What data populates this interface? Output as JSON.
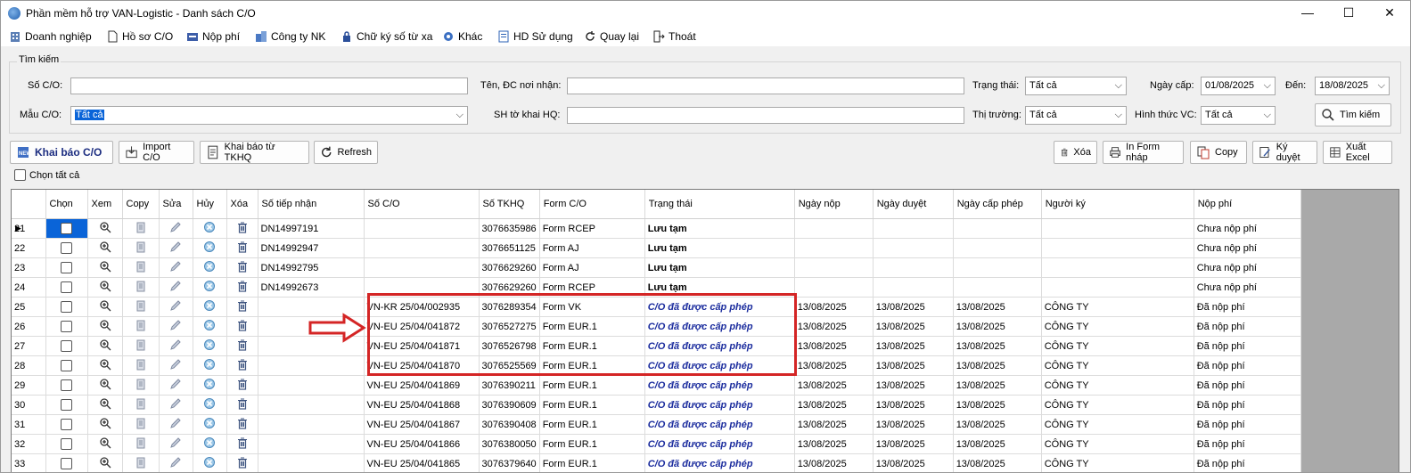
{
  "window": {
    "title": "Phần mềm hỗ trợ VAN-Logistic - Danh sách C/O",
    "minimize": "—",
    "maximize": "☐",
    "close": "✕"
  },
  "menu": [
    {
      "label": "Doanh nghiệp",
      "icon": "building-icon"
    },
    {
      "label": "Hồ sơ C/O",
      "icon": "document-icon"
    },
    {
      "label": "Nộp phí",
      "icon": "payment-icon"
    },
    {
      "label": "Công ty NK",
      "icon": "company-icon"
    },
    {
      "label": "Chữ ký số từ xa",
      "icon": "lock-icon"
    },
    {
      "label": "Khác",
      "icon": "gear-icon"
    },
    {
      "label": "HD Sử dụng",
      "icon": "help-icon"
    },
    {
      "label": "Quay lại",
      "icon": "back-icon"
    },
    {
      "label": "Thoát",
      "icon": "exit-icon"
    }
  ],
  "search": {
    "legend": "Tìm kiếm",
    "so_co_label": "Số C/O:",
    "so_co_value": "",
    "ten_dc_label": "Tên, ĐC nơi nhận:",
    "ten_dc_value": "",
    "trang_thai_label": "Trạng thái:",
    "trang_thai_value": "Tất cả",
    "ngay_cap_label": "Ngày cấp:",
    "ngay_cap_value": "01/08/2025",
    "den_label": "Đến:",
    "den_value": "18/08/2025",
    "mau_co_label": "Mẫu C/O:",
    "mau_co_value": "Tất cả",
    "sh_to_khai_label": "SH tờ khai HQ:",
    "sh_to_khai_value": "",
    "thi_truong_label": "Thị trường:",
    "thi_truong_value": "Tất cả",
    "hinh_thuc_label": "Hình thức VC:",
    "hinh_thuc_value": "Tất cả",
    "search_button": "Tìm kiếm"
  },
  "toolbar": {
    "khai_bao": "Khai báo C/O",
    "import": "Import C/O",
    "khai_bao_tkhq": "Khai báo từ TKHQ",
    "refresh": "Refresh",
    "xoa": "Xóa",
    "in_form": "In Form nháp",
    "copy": "Copy",
    "ky_duyet": "Ký duyệt",
    "xuat_excel": "Xuất Excel",
    "select_all": "Chọn tất cả"
  },
  "grid": {
    "headers": [
      "Chọn",
      "Xem",
      "Copy",
      "Sửa",
      "Hủy",
      "Xóa",
      "Số tiếp nhận",
      "Số C/O",
      "Số TKHQ",
      "Form C/O",
      "Trạng thái",
      "Ngày nộp",
      "Ngày duyệt",
      "Ngày cấp phép",
      "Người ký",
      "Nộp phí"
    ],
    "rows": [
      {
        "n": "21",
        "so_tn": "DN14997191",
        "so_co": "",
        "tkhq": "3076635986",
        "form": "Form RCEP",
        "status": "Lưu tạm",
        "st": "draft",
        "nop": "",
        "duyet": "",
        "cap": "",
        "ky": "",
        "phi": "Chưa nộp phí"
      },
      {
        "n": "22",
        "so_tn": "DN14992947",
        "so_co": "",
        "tkhq": "3076651125",
        "form": "Form AJ",
        "status": "Lưu tạm",
        "st": "draft",
        "nop": "",
        "duyet": "",
        "cap": "",
        "ky": "",
        "phi": "Chưa nộp phí"
      },
      {
        "n": "23",
        "so_tn": "DN14992795",
        "so_co": "",
        "tkhq": "3076629260",
        "form": "Form AJ",
        "status": "Lưu tạm",
        "st": "draft",
        "nop": "",
        "duyet": "",
        "cap": "",
        "ky": "",
        "phi": "Chưa nộp phí"
      },
      {
        "n": "24",
        "so_tn": "DN14992673",
        "so_co": "",
        "tkhq": "3076629260",
        "form": "Form RCEP",
        "status": "Lưu tạm",
        "st": "draft",
        "nop": "",
        "duyet": "",
        "cap": "",
        "ky": "",
        "phi": "Chưa nộp phí"
      },
      {
        "n": "25",
        "so_tn": "",
        "so_co": "VN-KR 25/04/002935",
        "tkhq": "3076289354",
        "form": "Form VK",
        "status": "C/O đã được cấp phép",
        "st": "ok",
        "nop": "13/08/2025",
        "duyet": "13/08/2025",
        "cap": "13/08/2025",
        "ky": "CÔNG TY",
        "phi": "Đã nộp phí"
      },
      {
        "n": "26",
        "so_tn": "",
        "so_co": "VN-EU 25/04/041872",
        "tkhq": "3076527275",
        "form": "Form EUR.1",
        "status": "C/O đã được cấp phép",
        "st": "ok",
        "nop": "13/08/2025",
        "duyet": "13/08/2025",
        "cap": "13/08/2025",
        "ky": "CÔNG TY",
        "phi": "Đã nộp phí"
      },
      {
        "n": "27",
        "so_tn": "",
        "so_co": "VN-EU 25/04/041871",
        "tkhq": "3076526798",
        "form": "Form EUR.1",
        "status": "C/O đã được cấp phép",
        "st": "ok",
        "nop": "13/08/2025",
        "duyet": "13/08/2025",
        "cap": "13/08/2025",
        "ky": "CÔNG TY",
        "phi": "Đã nộp phí"
      },
      {
        "n": "28",
        "so_tn": "",
        "so_co": "VN-EU 25/04/041870",
        "tkhq": "3076525569",
        "form": "Form EUR.1",
        "status": "C/O đã được cấp phép",
        "st": "ok",
        "nop": "13/08/2025",
        "duyet": "13/08/2025",
        "cap": "13/08/2025",
        "ky": "CÔNG TY",
        "phi": "Đã nộp phí"
      },
      {
        "n": "29",
        "so_tn": "",
        "so_co": "VN-EU 25/04/041869",
        "tkhq": "3076390211",
        "form": "Form EUR.1",
        "status": "C/O đã được cấp phép",
        "st": "ok",
        "nop": "13/08/2025",
        "duyet": "13/08/2025",
        "cap": "13/08/2025",
        "ky": "CÔNG TY",
        "phi": "Đã nộp phí"
      },
      {
        "n": "30",
        "so_tn": "",
        "so_co": "VN-EU 25/04/041868",
        "tkhq": "3076390609",
        "form": "Form EUR.1",
        "status": "C/O đã được cấp phép",
        "st": "ok",
        "nop": "13/08/2025",
        "duyet": "13/08/2025",
        "cap": "13/08/2025",
        "ky": "CÔNG TY",
        "phi": "Đã nộp phí"
      },
      {
        "n": "31",
        "so_tn": "",
        "so_co": "VN-EU 25/04/041867",
        "tkhq": "3076390408",
        "form": "Form EUR.1",
        "status": "C/O đã được cấp phép",
        "st": "ok",
        "nop": "13/08/2025",
        "duyet": "13/08/2025",
        "cap": "13/08/2025",
        "ky": "CÔNG TY",
        "phi": "Đã nộp phí"
      },
      {
        "n": "32",
        "so_tn": "",
        "so_co": "VN-EU 25/04/041866",
        "tkhq": "3076380050",
        "form": "Form EUR.1",
        "status": "C/O đã được cấp phép",
        "st": "ok",
        "nop": "13/08/2025",
        "duyet": "13/08/2025",
        "cap": "13/08/2025",
        "ky": "CÔNG TY",
        "phi": "Đã nộp phí"
      },
      {
        "n": "33",
        "so_tn": "",
        "so_co": "VN-EU 25/04/041865",
        "tkhq": "3076379640",
        "form": "Form EUR.1",
        "status": "C/O đã được cấp phép",
        "st": "ok",
        "nop": "13/08/2025",
        "duyet": "13/08/2025",
        "cap": "13/08/2025",
        "ky": "CÔNG TY",
        "phi": "Đã nộp phí"
      }
    ]
  },
  "colors": {
    "accent": "#0a64d8",
    "approved_text": "#1c2d9e",
    "annotation_red": "#d42525"
  }
}
